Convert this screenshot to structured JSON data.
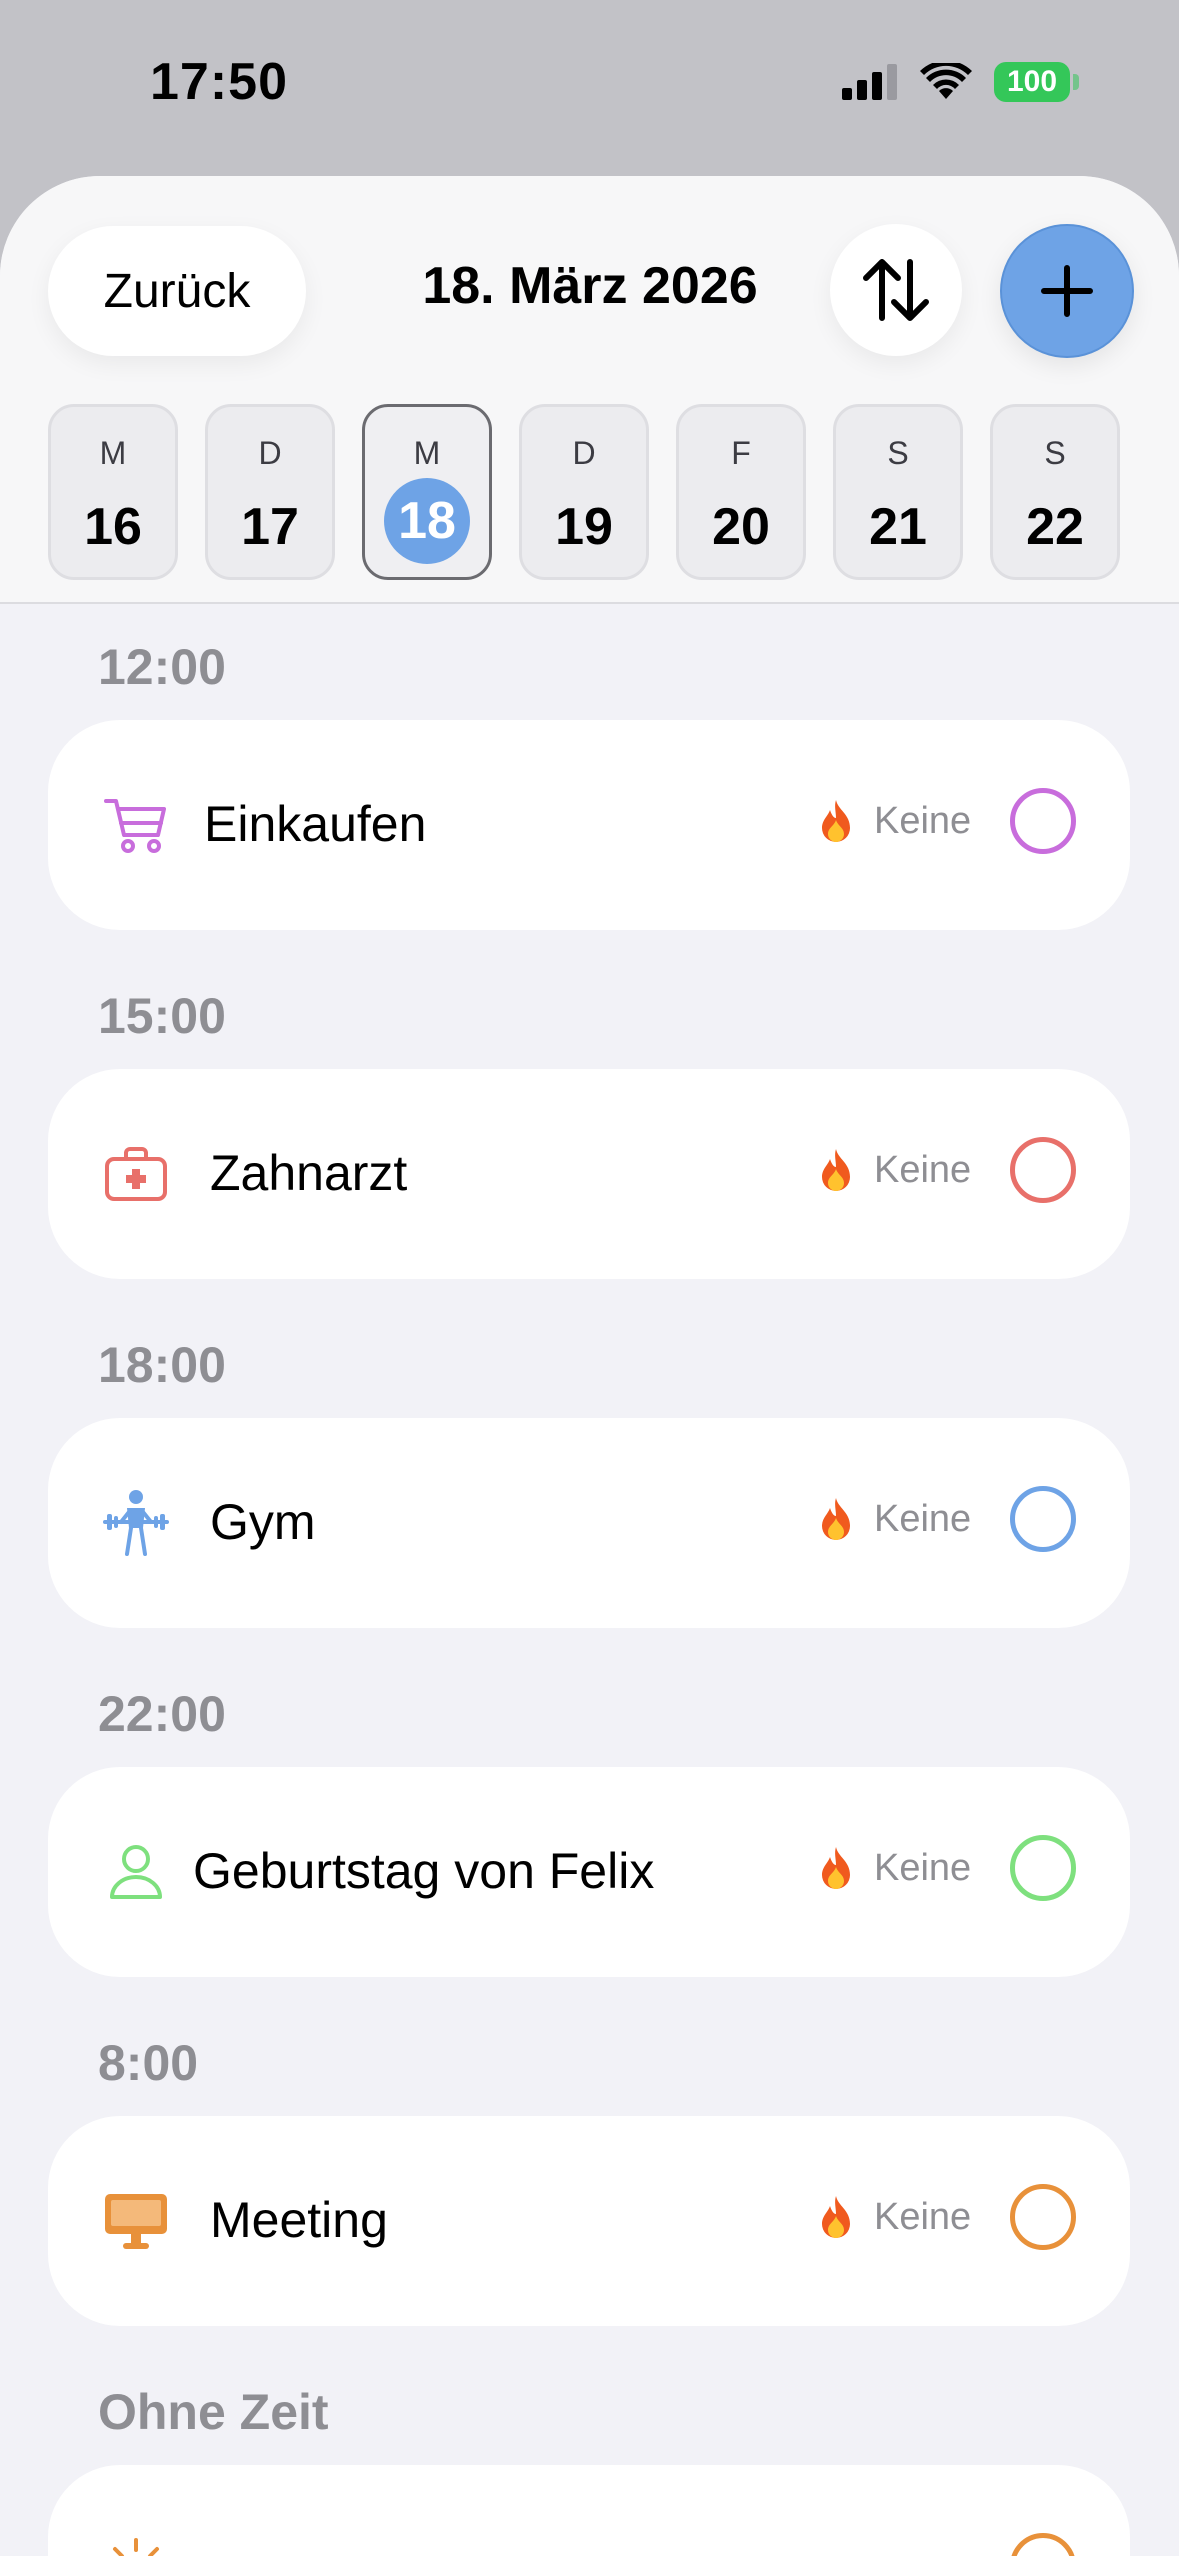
{
  "status_bar": {
    "time": "17:50",
    "battery": "100"
  },
  "header": {
    "back_label": "Zurück",
    "date_title": "18. März 2026",
    "sort_icon": "arrow-up-down-icon",
    "add_icon": "plus-icon"
  },
  "week": [
    {
      "letter": "M",
      "num": "16",
      "selected": false
    },
    {
      "letter": "D",
      "num": "17",
      "selected": false
    },
    {
      "letter": "M",
      "num": "18",
      "selected": true
    },
    {
      "letter": "D",
      "num": "19",
      "selected": false
    },
    {
      "letter": "F",
      "num": "20",
      "selected": false
    },
    {
      "letter": "S",
      "num": "21",
      "selected": false
    },
    {
      "letter": "S",
      "num": "22",
      "selected": false
    }
  ],
  "sections": [
    {
      "label": "12:00",
      "task": {
        "title": "Einkaufen",
        "status": "Keine",
        "icon": "shopping-cart-icon",
        "color": "#c86ddc"
      }
    },
    {
      "label": "15:00",
      "task": {
        "title": "Zahnarzt",
        "status": "Keine",
        "icon": "medical-kit-icon",
        "color": "#e8706a"
      }
    },
    {
      "label": "18:00",
      "task": {
        "title": "Gym",
        "status": "Keine",
        "icon": "weightlifter-icon",
        "color": "#6ea3e6"
      }
    },
    {
      "label": "22:00",
      "task": {
        "title": "Geburtstag von Felix",
        "status": "Keine",
        "icon": "person-icon",
        "color": "#7ee07e"
      }
    },
    {
      "label": "8:00",
      "task": {
        "title": "Meeting",
        "status": "Keine",
        "icon": "desktop-computer-icon",
        "color": "#e8913a"
      }
    },
    {
      "label": "Ohne Zeit",
      "task": {
        "title": "",
        "status": "",
        "icon": "sun-icon",
        "color": "#e8913a"
      }
    }
  ]
}
